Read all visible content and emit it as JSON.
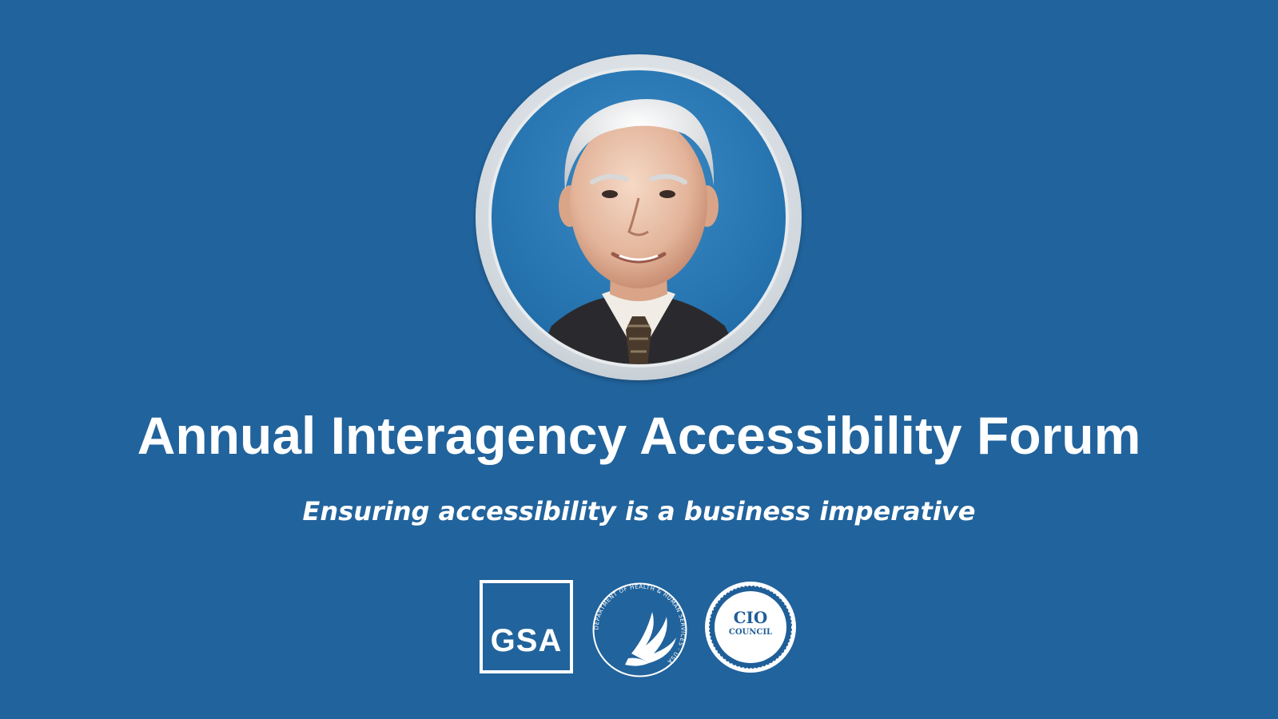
{
  "colors": {
    "background": "#21639c",
    "text": "#ffffff",
    "portrait_background": "#2b78b3"
  },
  "portrait": {
    "icon": "speaker-portrait"
  },
  "heading": {
    "title": "Annual Interagency Accessibility Forum",
    "subtitle": "Ensuring accessibility is a business imperative"
  },
  "logos": {
    "gsa": {
      "text": "GSA"
    },
    "hhs": {
      "icon": "hhs-eagle-seal",
      "ring_text": "DEPARTMENT OF HEALTH & HUMAN SERVICES · USA"
    },
    "cio": {
      "line1": "CIO",
      "line2": "COUNCIL"
    }
  }
}
